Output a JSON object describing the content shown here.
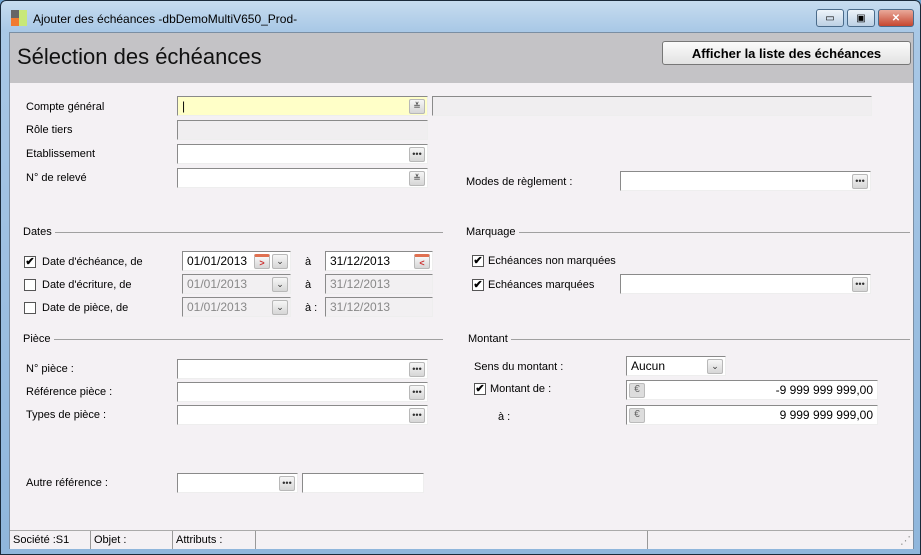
{
  "window": {
    "title": "Ajouter des échéances -dbDemoMultiV650_Prod-",
    "minimize": "▭",
    "maximize": "▣",
    "close": "✕"
  },
  "header": {
    "title": "Sélection des échéances",
    "button": "Afficher la liste des échéances"
  },
  "fields": {
    "compte_general": {
      "label": "Compte général",
      "value": ""
    },
    "role_tiers": {
      "label": "Rôle tiers"
    },
    "etablissement": {
      "label": "Etablissement"
    },
    "releve": {
      "label": "N° de relevé"
    },
    "modes_reglement": {
      "label": "Modes de règlement :"
    }
  },
  "dates": {
    "title": "Dates",
    "a": "à",
    "a2": "à :",
    "rows": [
      {
        "label": "Date d'échéance, de",
        "checked": true,
        "from": "01/01/2013",
        "to": "31/12/2013"
      },
      {
        "label": "Date d'écriture, de",
        "checked": false,
        "from": "01/01/2013",
        "to": "31/12/2013"
      },
      {
        "label": "Date de pièce, de",
        "checked": false,
        "from": "01/01/2013",
        "to": "31/12/2013"
      }
    ]
  },
  "marquage": {
    "title": "Marquage",
    "non_marquees": "Echéances non marquées",
    "marquees": "Echéances marquées"
  },
  "piece": {
    "title": "Pièce",
    "numero": "N° pièce :",
    "reference": "Référence pièce :",
    "types": "Types de pièce :",
    "autre": "Autre référence :"
  },
  "montant": {
    "title": "Montant",
    "sens_label": "Sens du montant :",
    "sens_value": "Aucun",
    "de_label": "Montant de :",
    "de_value": "-9 999 999 999,00",
    "a_label": "à :",
    "a_value": "9 999 999 999,00",
    "currency": "€"
  },
  "status": {
    "societe": "Société :S1",
    "objet": "Objet :",
    "attributs": "Attributs :"
  },
  "icons": {
    "check": "✔",
    "dots": "•••",
    "dbl_chevron": "≚",
    "chevron": "⌄",
    "cal_next": ">",
    "cal_prev": "<"
  }
}
